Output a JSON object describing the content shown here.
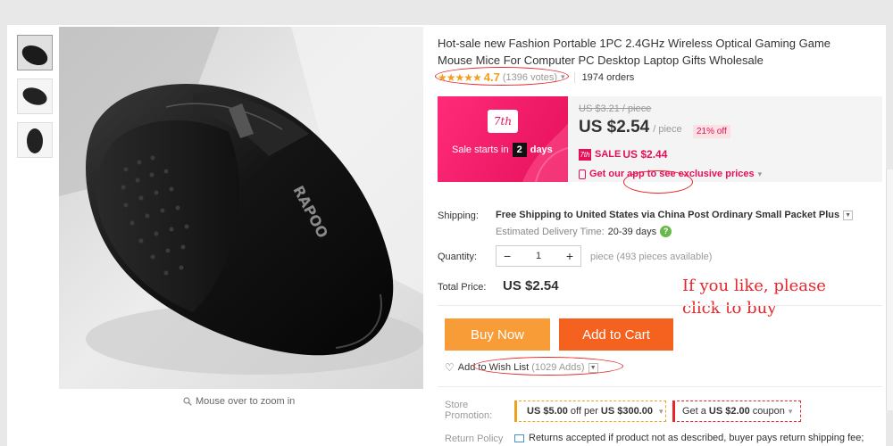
{
  "gallery": {
    "thumbnails": [
      "mouse-thumb-1",
      "mouse-thumb-2",
      "mouse-thumb-3"
    ],
    "main_image": "wireless-gaming-mouse-photo",
    "brand_mark": "RAPOO",
    "zoom_hint": "Mouse over to zoom in"
  },
  "product": {
    "title": "Hot-sale new Fashion Portable 1PC 2.4GHz Wireless Optical Gaming Game Mouse Mice For Computer PC Desktop Laptop Gifts Wholesale",
    "stars": "★★★★★",
    "rating": "4.7",
    "votes": "(1396 votes)",
    "orders": "1974 orders"
  },
  "pricing": {
    "promo_badge": "7th",
    "sale_starts_label": "Sale starts in",
    "sale_days_value": "2",
    "sale_days_unit": "days",
    "old_price": "US $3.21 / piece",
    "current_price": "US $2.54",
    "per_piece": "/ piece",
    "discount": "21% off",
    "sale_icon_text": "7th",
    "sale_label": "SALE",
    "sale_price": "US $2.44",
    "app_prices": "Get our app to see exclusive prices"
  },
  "shipping": {
    "label": "Shipping:",
    "method": "Free Shipping to United States via China Post Ordinary Small Packet Plus",
    "estimate_label": "Estimated Delivery Time:",
    "estimate_days": "20-39 days"
  },
  "quantity": {
    "label": "Quantity:",
    "value": "1",
    "minus": "−",
    "plus": "+",
    "note": "piece (493 pieces available)"
  },
  "total": {
    "label": "Total Price:",
    "value": "US $2.54"
  },
  "annotation": {
    "line1": "If you like, please",
    "line2": "click to buy"
  },
  "actions": {
    "buy_now": "Buy Now",
    "add_to_cart": "Add to Cart",
    "wish_list": "Add to Wish List",
    "wish_adds": "(1029 Adds)"
  },
  "store_promotion": {
    "label_line1": "Store",
    "label_line2": "Promotion:",
    "coupon1_amount": "US $5.00",
    "coupon1_mid": "off per",
    "coupon1_threshold": "US $300.00",
    "coupon2_prefix": "Get a",
    "coupon2_amount": "US $2.00",
    "coupon2_suffix": "coupon"
  },
  "return_policy": {
    "label": "Return Policy",
    "text": "Returns accepted if product not as described, buyer pays return shipping fee;"
  },
  "colors": {
    "accent_pink": "#e6105a",
    "buy_orange": "#f89c37",
    "cart_orange": "#f5611e",
    "star_gold": "#f0a11b",
    "annotation_red": "#e8252a"
  }
}
